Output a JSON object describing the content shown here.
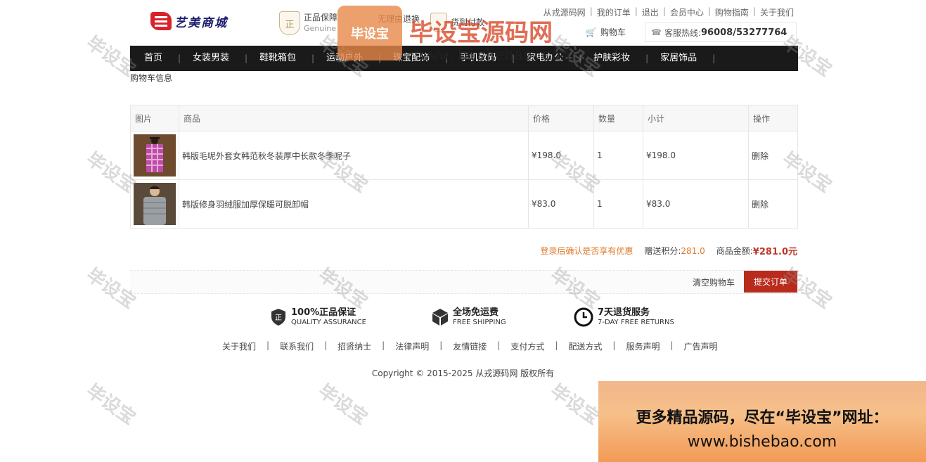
{
  "header": {
    "logo_text": "艺美商城",
    "assurances": [
      {
        "title": "正品保障",
        "subtitle": "Genuine"
      },
      {
        "title": "无理由退换",
        "subtitle": ""
      },
      {
        "title": "货到付款",
        "subtitle": ""
      }
    ],
    "toplinks": [
      "从戎源码网",
      "我的订单",
      "退出",
      "会员中心",
      "购物指南",
      "关于我们"
    ],
    "cart_label": "购物车",
    "hotline_label": "客服热线:",
    "hotline_number": "96008/53277764"
  },
  "nav": [
    "首页",
    "女装男装",
    "鞋靴箱包",
    "运动户外",
    "珠宝配饰",
    "手机数码",
    "家电办公",
    "护肤彩妆",
    "家居饰品"
  ],
  "breadcrumb": "购物车信息",
  "cart": {
    "columns": [
      "图片",
      "商品",
      "价格",
      "数量",
      "小计",
      "操作"
    ],
    "rows": [
      {
        "name": "韩版毛呢外套女韩范秋冬装厚中长款冬季呢子",
        "price": "¥198.0",
        "qty": "1",
        "subtotal": "¥198.0",
        "action": "删除",
        "img": "plaid-coat"
      },
      {
        "name": "韩版修身羽绒服加厚保暖可脱卸帽",
        "price": "¥83.0",
        "qty": "1",
        "subtotal": "¥83.0",
        "action": "删除",
        "img": "grey-jacket"
      }
    ]
  },
  "summary": {
    "login_tip": "登录后确认是否享有优惠",
    "points_label": "赠送积分:",
    "points_value": "281.0",
    "amount_label": "商品金额:",
    "amount_value": "¥281.0元"
  },
  "actions": {
    "clear_label": "清空购物车",
    "submit_label": "提交订单"
  },
  "services": [
    {
      "title": "100%正品保证",
      "subtitle": "QUALITY ASSURANCE",
      "icon": "shield-icon"
    },
    {
      "title": "全场免运费",
      "subtitle": "FREE SHIPPING",
      "icon": "box-icon"
    },
    {
      "title": "7天退货服务",
      "subtitle": "7-DAY FREE RETURNS",
      "icon": "clock-icon"
    }
  ],
  "footer_links": [
    "关于我们",
    "联系我们",
    "招贤纳士",
    "法律声明",
    "友情链接",
    "支付方式",
    "配送方式",
    "服务声明",
    "广告声明"
  ],
  "copyright": "Copyright © 2015-2025 从戎源码网 版权所有",
  "watermark": {
    "text": "毕设宝",
    "title": "毕设宝源码网",
    "url": "www.bishebao.com",
    "promo_line1": "更多精品源码，尽在“毕设宝”网址：",
    "promo_line2": "www.bishebao.com"
  },
  "colors": {
    "nav_bg": "#1a1a1a",
    "accent_red": "#b92b1c",
    "accent_orange": "#e07a2a"
  }
}
